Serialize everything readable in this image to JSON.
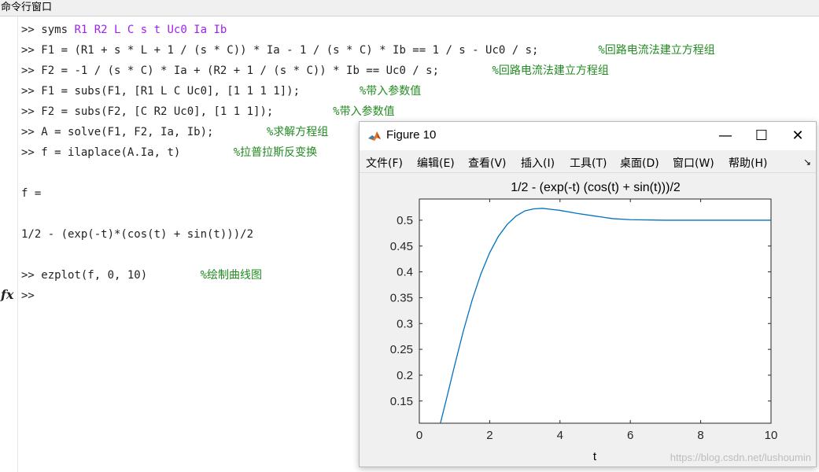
{
  "panel": {
    "title": "命令行窗口"
  },
  "prompt_symbol": "fx",
  "commands": [
    {
      "prompt": ">> ",
      "code": "syms ",
      "kw": "R1 R2 L C s t Uc0 Ia Ib",
      "comment": ""
    },
    {
      "prompt": ">> ",
      "code": "F1 = (R1 + s * L + 1 / (s * C)) * Ia - 1 / (s * C) * Ib == 1 / s - Uc0 / s;         ",
      "kw": "",
      "comment": "%回路电流法建立方程组"
    },
    {
      "prompt": ">> ",
      "code": "F2 = -1 / (s * C) * Ia + (R2 + 1 / (s * C)) * Ib == Uc0 / s;        ",
      "kw": "",
      "comment": "%回路电流法建立方程组"
    },
    {
      "prompt": ">> ",
      "code": "F1 = subs(F1, [R1 L C Uc0], [1 1 1 1]);         ",
      "kw": "",
      "comment": "%带入参数值"
    },
    {
      "prompt": ">> ",
      "code": "F2 = subs(F2, [C R2 Uc0], [1 1 1]);         ",
      "kw": "",
      "comment": "%带入参数值"
    },
    {
      "prompt": ">> ",
      "code": "A = solve(F1, F2, Ia, Ib);        ",
      "kw": "",
      "comment": "%求解方程组"
    },
    {
      "prompt": ">> ",
      "code": "f = ilaplace(A.Ia, t)        ",
      "kw": "",
      "comment": "%拉普拉斯反变换"
    }
  ],
  "output_var": "f =",
  "output_value": "1/2 - (exp(-t)*(cos(t) + sin(t)))/2",
  "last_command": {
    "prompt": ">> ",
    "code": "ezplot(f, 0, 10)        ",
    "comment": "%绘制曲线图"
  },
  "current_prompt": ">>",
  "figure": {
    "window_title": "Figure 10",
    "controls": {
      "minimize": "—",
      "maximize": "☐",
      "close": "✕"
    },
    "menu": [
      "文件(F)",
      "编辑(E)",
      "查看(V)",
      "插入(I)",
      "工具(T)",
      "桌面(D)",
      "窗口(W)",
      "帮助(H)"
    ],
    "dock_arrow": "↘",
    "watermark": "https://blog.csdn.net/lushoumin"
  },
  "colors": {
    "keyword": "#a020f0",
    "comment": "#228b22",
    "line": "#0072bd"
  },
  "chart_data": {
    "type": "line",
    "title": "1/2 - (exp(-t) (cos(t) + sin(t)))/2",
    "xlabel": "t",
    "ylabel": "",
    "xlim": [
      0,
      10
    ],
    "ylim": [
      0.107,
      0.541
    ],
    "xticks": [
      0,
      2,
      4,
      6,
      8,
      10
    ],
    "yticks": [
      0.15,
      0.2,
      0.25,
      0.3,
      0.35,
      0.4,
      0.45,
      0.5
    ],
    "xtick_labels": [
      "0",
      "2",
      "4",
      "6",
      "8",
      "10"
    ],
    "ytick_labels": [
      "0.15",
      "0.2",
      "0.25",
      "0.3",
      "0.35",
      "0.4",
      "0.45",
      "0.5"
    ],
    "series": [
      {
        "x": [
          0.5,
          0.75,
          1,
          1.25,
          1.5,
          1.75,
          2,
          2.25,
          2.5,
          2.75,
          3,
          3.25,
          3.5,
          3.75,
          4,
          4.5,
          5,
          5.5,
          6,
          7,
          8,
          9,
          10
        ],
        "y": [
          0.08,
          0.148,
          0.218,
          0.285,
          0.345,
          0.396,
          0.437,
          0.469,
          0.492,
          0.508,
          0.518,
          0.522,
          0.523,
          0.521,
          0.519,
          0.513,
          0.508,
          0.503,
          0.501,
          0.5,
          0.5,
          0.5,
          0.5
        ]
      }
    ],
    "grid": false,
    "box": true
  }
}
